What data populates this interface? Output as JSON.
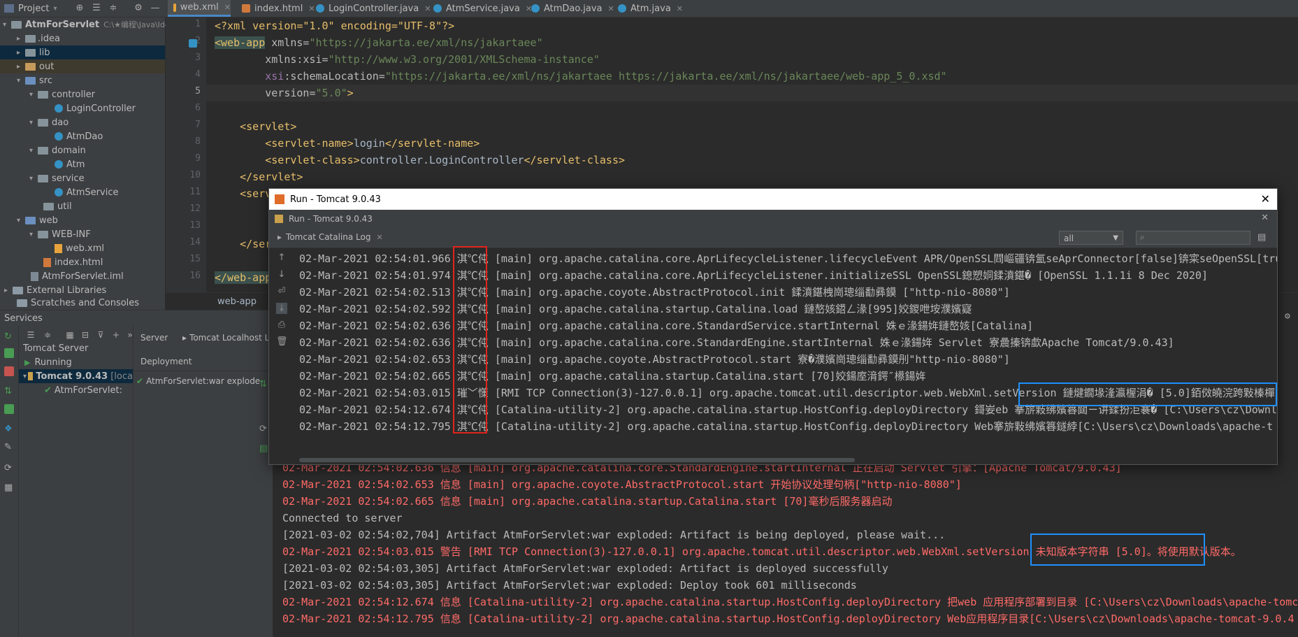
{
  "project_panel": {
    "title": "Project"
  },
  "editor_tabs": [
    {
      "label": "web.xml",
      "active": true
    },
    {
      "label": "index.html"
    },
    {
      "label": "LoginController.java"
    },
    {
      "label": "AtmService.java"
    },
    {
      "label": "AtmDao.java"
    },
    {
      "label": "Atm.java"
    }
  ],
  "tree": {
    "root": "AtmForServlet",
    "root_path": "C:\\★编程\\Java\\Ide",
    "items": [
      "idea",
      "lib",
      "out",
      "src",
      "controller",
      "LoginController",
      "dao",
      "AtmDao",
      "domain",
      "Atm",
      "service",
      "AtmService",
      "util",
      "web",
      "WEB-INF",
      "web.xml",
      "index.html",
      "AtmForServlet.iml",
      "External Libraries",
      "Scratches and Consoles"
    ]
  },
  "code_lines": {
    "line_numbers": [
      "1",
      "2",
      "3",
      "4",
      "5",
      "6",
      "7",
      "8",
      "9",
      "10",
      "11",
      "12",
      "13",
      "14",
      "15",
      "16"
    ],
    "l1": "<?xml version=\"1.0\" encoding=\"UTF-8\"?>",
    "l2_tag": "<web-app",
    "l2_attr": " xmlns=",
    "l2_val": "\"https://jakarta.ee/xml/ns/jakartaee\"",
    "l3_ns": "xmlns:xsi=",
    "l3_val": "\"http://www.w3.org/2001/XMLSchema-instance\"",
    "l4_ns": "xsi",
    "l4_attr": ":schemaLocation=",
    "l4_val": "\"https://jakarta.ee/xml/ns/jakartaee https://jakarta.ee/xml/ns/jakartaee/web-app_5_0.xsd\"",
    "l5_attr": "version=",
    "l5_val": "\"5.0\"",
    "l5_end": ">",
    "l7": "<servlet>",
    "l8_open": "<servlet-name>",
    "l8_text": "login",
    "l8_close": "</servlet-name>",
    "l9_open": "<servlet-class>",
    "l9_text": "controller.LoginController",
    "l9_close": "</servlet-class>",
    "l10": "</servlet>",
    "l11": "<serv",
    "l14": "</serv",
    "l16": "</web-app"
  },
  "breadcrumb": "web-app",
  "services": {
    "title": "Services",
    "tab_server": "Server",
    "tab_tomcat_log": "Tomcat Localhost Lo",
    "deployment": "Deployment",
    "deploy_item": "AtmForServlet:war explode",
    "tree": [
      "Tomcat Server",
      "Running",
      "Tomcat 9.0.43",
      "[loca",
      "AtmForServlet:"
    ]
  },
  "dialog": {
    "title": "Run - Tomcat 9.0.43",
    "inner_title": "Run - Tomcat 9.0.43",
    "log_tab": "Tomcat Catalina Log",
    "filter": "all",
    "lines": [
      {
        "ts": "02-Mar-2021 02:54:01.966",
        "lvl": "淇℃伅",
        "msg": "[main] org.apache.catalina.core.AprLifecycleListener.lifecycleEvent APR/OpenSSL閰嶇疆锛氳seAprConnector[false]锛寀seOpenSSL[tru"
      },
      {
        "ts": "02-Mar-2021 02:54:01.974",
        "lvl": "淇℃伅",
        "msg": "[main] org.apache.catalina.core.AprLifecycleListener.initializeSSL OpenSSL鎴愬姛鍒濆鍖� [OpenSSL 1.1.1i  8 Dec 2020]"
      },
      {
        "ts": "02-Mar-2021 02:54:02.513",
        "lvl": "淇℃伅",
        "msg": "[main] org.apache.coyote.AbstractProtocol.init 鍒濆鍖栧崗璁缁勫彞鏌 [\"http-nio-8080\"]"
      },
      {
        "ts": "02-Mar-2021 02:54:02.592",
        "lvl": "淇℃伅",
        "msg": "[main] org.apache.catalina.startup.Catalina.load 鏈嶅姟鍣ㄥ湪[995]姣鍐呭垵濮嬪寲"
      },
      {
        "ts": "02-Mar-2021 02:54:02.636",
        "lvl": "淇℃伅",
        "msg": "[main] org.apache.catalina.core.StandardService.startInternal 姝ｅ湪鍚姩鏈嶅姟[Catalina]"
      },
      {
        "ts": "02-Mar-2021 02:54:02.636",
        "lvl": "淇℃伅",
        "msg": "[main] org.apache.catalina.core.StandardEngine.startInternal 姝ｅ湪鍚姩 Servlet 寮曟搸锛歔Apache Tomcat/9.0.43]"
      },
      {
        "ts": "02-Mar-2021 02:54:02.653",
        "lvl": "淇℃伅",
        "msg": "[main] org.apache.coyote.AbstractProtocol.start 寮�濮嬪崗璁缁勫彞鏌刐\"http-nio-8080\"]"
      },
      {
        "ts": "02-Mar-2021 02:54:02.665",
        "lvl": "淇℃伅",
        "msg": "[main] org.apache.catalina.startup.Catalina.start [70]姣鍚庢湇鍔″櫒鍚姩"
      },
      {
        "ts": "02-Mar-2021 02:54:03.015",
        "lvl": "璀﹀憡",
        "msg": "[RMI TCP Connection(3)-127.0.0.1] org.apache.tomcat.util.descriptor.web.WebXml.setVersion 鏈煡鐗堟湰瀛楃涓� [5.0]銆傚皢浣跨敤榛樿"
      },
      {
        "ts": "02-Mar-2021 02:54:12.674",
        "lvl": "淇℃伅",
        "msg": "[Catalina-utility-2] org.apache.catalina.startup.HostConfig.deployDirectory 鎶妛eb 搴旂敤绋嬪簭閮ㄧ讲鍒扮洰褰� [C:\\Users\\cz\\Downl"
      },
      {
        "ts": "02-Mar-2021 02:54:12.795",
        "lvl": "淇℃伅",
        "msg": "[Catalina-utility-2] org.apache.catalina.startup.HostConfig.deployDirectory Web搴旂敤绋嬪簭鐩綍[C:\\Users\\cz\\Downloads\\apache-t"
      }
    ]
  },
  "console_lines": [
    {
      "text": "02-Mar-2021 02:54:02.636 信息 [main] org.apache.catalina.core.StandardEngine.startInternal 正在启动 Servlet 引擎：[Apache Tomcat/9.0.43]",
      "color": "red"
    },
    {
      "text": "02-Mar-2021 02:54:02.653 信息 [main] org.apache.coyote.AbstractProtocol.start 开始协议处理句柄[\"http-nio-8080\"]",
      "color": "red"
    },
    {
      "text": "02-Mar-2021 02:54:02.665 信息 [main] org.apache.catalina.startup.Catalina.start [70]毫秒后服务器启动",
      "color": "red"
    },
    {
      "text": "Connected to server",
      "color": "gray"
    },
    {
      "text": "[2021-03-02 02:54:02,704] Artifact AtmForServlet:war exploded: Artifact is being deployed, please wait...",
      "color": "gray"
    },
    {
      "text": "02-Mar-2021 02:54:03.015 警告 [RMI TCP Connection(3)-127.0.0.1] org.apache.tomcat.util.descriptor.web.WebXml.setVersion 未知版本字符串 [5.0]。将使用默认版本。",
      "color": "red"
    },
    {
      "text": "[2021-03-02 02:54:03,305] Artifact AtmForServlet:war exploded: Artifact is deployed successfully",
      "color": "gray"
    },
    {
      "text": "[2021-03-02 02:54:03,305] Artifact AtmForServlet:war exploded: Deploy took 601 milliseconds",
      "color": "gray"
    },
    {
      "text": "02-Mar-2021 02:54:12.674 信息 [Catalina-utility-2] org.apache.catalina.startup.HostConfig.deployDirectory 把web 应用程序部署到目录 [C:\\Users\\cz\\Downloads\\apache-tomc",
      "color": "red"
    },
    {
      "text": "02-Mar-2021 02:54:12.795 信息 [Catalina-utility-2] org.apache.catalina.startup.HostConfig.deployDirectory Web应用程序目录[C:\\Users\\cz\\Downloads\\apache-tomcat-9.0.4",
      "color": "red"
    }
  ],
  "colors": {
    "error_red": "#ff6b68",
    "highlight_blue": "#1e90ff",
    "highlight_red": "#e0241b",
    "accent": "#4a88c7"
  }
}
